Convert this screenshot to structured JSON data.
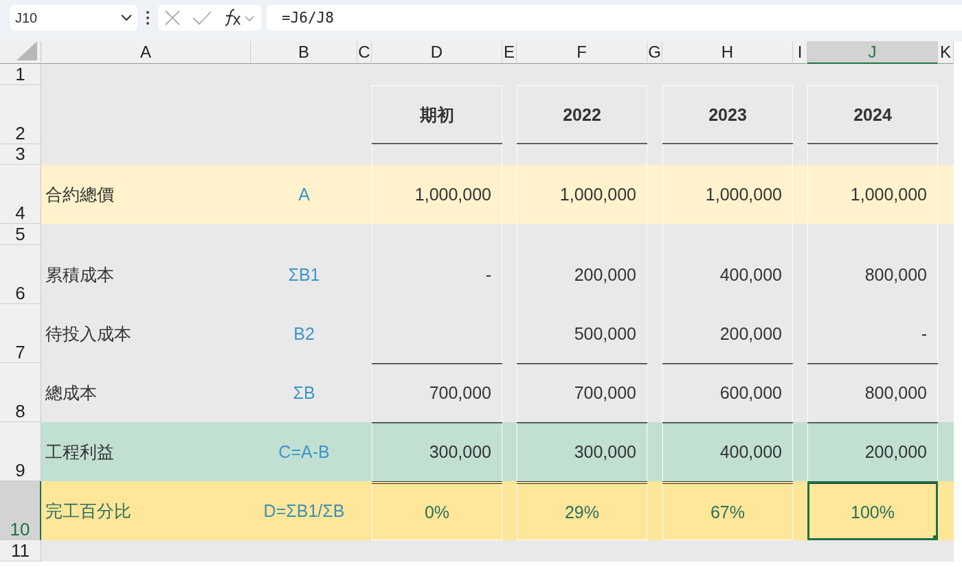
{
  "name_box": {
    "value": "J10"
  },
  "formula_bar": {
    "formula": "=J6/J8"
  },
  "columns": [
    {
      "label": "A",
      "selected": false
    },
    {
      "label": "B",
      "selected": false
    },
    {
      "label": "C",
      "selected": false
    },
    {
      "label": "D",
      "selected": false
    },
    {
      "label": "E",
      "selected": false
    },
    {
      "label": "F",
      "selected": false
    },
    {
      "label": "G",
      "selected": false
    },
    {
      "label": "H",
      "selected": false
    },
    {
      "label": "I",
      "selected": false
    },
    {
      "label": "J",
      "selected": true
    },
    {
      "label": "K",
      "selected": false
    }
  ],
  "rows": [
    {
      "number": "1",
      "kind": "spacer",
      "selected": false
    },
    {
      "number": "2",
      "kind": "header",
      "selected": false,
      "values": [
        "期初",
        "2022",
        "2023",
        "2024"
      ]
    },
    {
      "number": "3",
      "kind": "gap",
      "selected": false
    },
    {
      "number": "4",
      "kind": "contract",
      "selected": false,
      "label": "合約總價",
      "code": "A",
      "values": [
        "1,000,000",
        "1,000,000",
        "1,000,000",
        "1,000,000"
      ]
    },
    {
      "number": "5",
      "kind": "gap",
      "selected": false
    },
    {
      "number": "6",
      "kind": "item",
      "selected": false,
      "label": "累積成本",
      "code": "ΣB1",
      "values": [
        "-",
        "200,000",
        "400,000",
        "800,000"
      ]
    },
    {
      "number": "7",
      "kind": "item",
      "selected": false,
      "label": "待投入成本",
      "code": "B2",
      "values": [
        {
          "kind": "blank"
        },
        {
          "kind": "number",
          "text": "500,000"
        },
        {
          "kind": "number",
          "text": "200,000"
        },
        {
          "kind": "number",
          "text": "-"
        }
      ]
    },
    {
      "number": "8",
      "kind": "total",
      "selected": false,
      "label": "總成本",
      "code": "ΣB",
      "values": [
        "700,000",
        "700,000",
        "600,000",
        "800,000"
      ]
    },
    {
      "number": "9",
      "kind": "profit",
      "selected": false,
      "label": "工程利益",
      "code": "C=A-B",
      "values": [
        "300,000",
        "300,000",
        "400,000",
        "200,000"
      ]
    },
    {
      "number": "10",
      "kind": "percent",
      "selected": true,
      "label": "完工百分比",
      "code": "D=ΣB1/ΣB",
      "values": [
        "0%",
        "29%",
        "67%",
        "100%"
      ]
    },
    {
      "number": "11",
      "kind": "spacer",
      "selected": false
    }
  ]
}
